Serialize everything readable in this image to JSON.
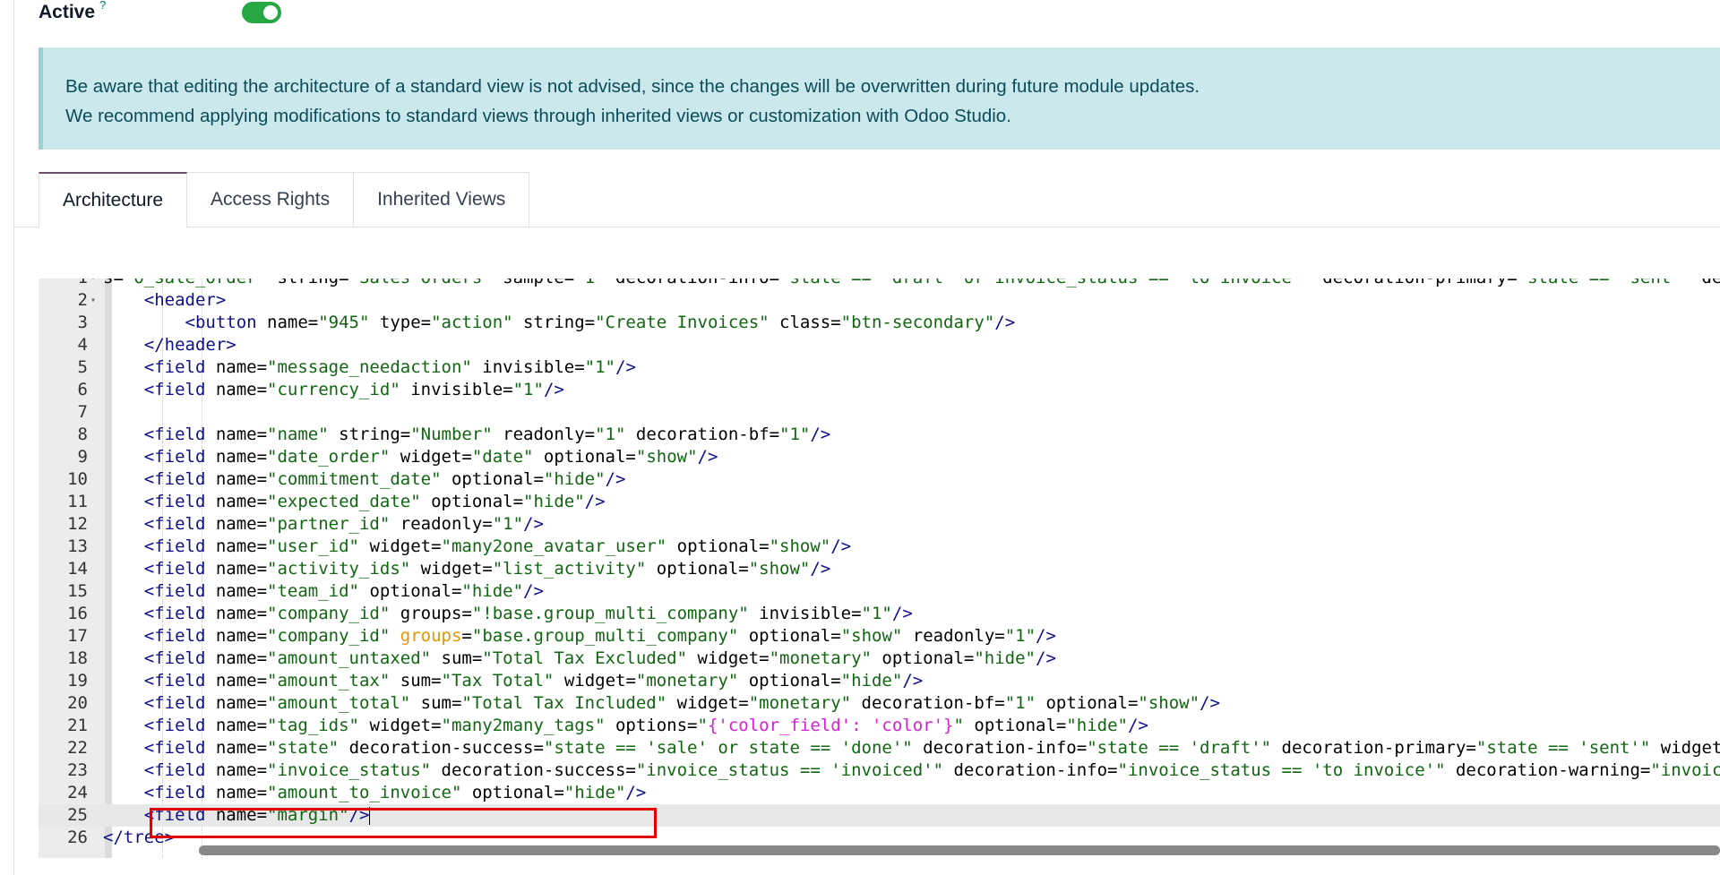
{
  "active_row": {
    "label": "Active",
    "help": "?",
    "toggle_on": true
  },
  "alert": {
    "line1": "Be aware that editing the architecture of a standard view is not advised, since the changes will be overwritten during future module updates.",
    "line2": "We recommend applying modifications to standard views through inherited views or customization with Odoo Studio."
  },
  "tabs": [
    {
      "label": "Architecture",
      "active": true
    },
    {
      "label": "Access Rights",
      "active": false
    },
    {
      "label": "Inherited Views",
      "active": false
    }
  ],
  "editor": {
    "colors": {
      "tag": "#0f0f8c",
      "attr": "#000000",
      "value": "#116611",
      "keyword_attr": "#e69500",
      "option_value": "#d81ed8"
    },
    "current_line": 25,
    "lines": [
      {
        "n": 1,
        "fold": true,
        "tokens": [
          [
            "a",
            "s="
          ],
          [
            "v",
            "\"o_sale_order\""
          ],
          [
            "a",
            " string="
          ],
          [
            "v",
            "\"Sales Orders\""
          ],
          [
            "a",
            " sample="
          ],
          [
            "v",
            "\"1\""
          ],
          [
            "a",
            " decoration-info="
          ],
          [
            "v",
            "\"state == 'draft' or invoice_status == 'to invoice'\""
          ],
          [
            "a",
            " decoration-primary="
          ],
          [
            "v",
            "\"state == 'sent'\""
          ],
          [
            "a",
            " decorati"
          ]
        ]
      },
      {
        "n": 2,
        "fold": true,
        "tokens": [
          [
            "a",
            "    "
          ],
          [
            "t",
            "<header>"
          ]
        ]
      },
      {
        "n": 3,
        "tokens": [
          [
            "a",
            "        "
          ],
          [
            "t",
            "<button"
          ],
          [
            "a",
            " name="
          ],
          [
            "v",
            "\"945\""
          ],
          [
            "a",
            " type="
          ],
          [
            "v",
            "\"action\""
          ],
          [
            "a",
            " string="
          ],
          [
            "v",
            "\"Create Invoices\""
          ],
          [
            "a",
            " class="
          ],
          [
            "v",
            "\"btn-secondary\""
          ],
          [
            "t",
            "/>"
          ]
        ]
      },
      {
        "n": 4,
        "tokens": [
          [
            "a",
            "    "
          ],
          [
            "t",
            "</header>"
          ]
        ]
      },
      {
        "n": 5,
        "tokens": [
          [
            "a",
            "    "
          ],
          [
            "t",
            "<field"
          ],
          [
            "a",
            " name="
          ],
          [
            "v",
            "\"message_needaction\""
          ],
          [
            "a",
            " invisible="
          ],
          [
            "v",
            "\"1\""
          ],
          [
            "t",
            "/>"
          ]
        ]
      },
      {
        "n": 6,
        "tokens": [
          [
            "a",
            "    "
          ],
          [
            "t",
            "<field"
          ],
          [
            "a",
            " name="
          ],
          [
            "v",
            "\"currency_id\""
          ],
          [
            "a",
            " invisible="
          ],
          [
            "v",
            "\"1\""
          ],
          [
            "t",
            "/>"
          ]
        ]
      },
      {
        "n": 7,
        "tokens": []
      },
      {
        "n": 8,
        "tokens": [
          [
            "a",
            "    "
          ],
          [
            "t",
            "<field"
          ],
          [
            "a",
            " name="
          ],
          [
            "v",
            "\"name\""
          ],
          [
            "a",
            " string="
          ],
          [
            "v",
            "\"Number\""
          ],
          [
            "a",
            " readonly="
          ],
          [
            "v",
            "\"1\""
          ],
          [
            "a",
            " decoration-bf="
          ],
          [
            "v",
            "\"1\""
          ],
          [
            "t",
            "/>"
          ]
        ]
      },
      {
        "n": 9,
        "tokens": [
          [
            "a",
            "    "
          ],
          [
            "t",
            "<field"
          ],
          [
            "a",
            " name="
          ],
          [
            "v",
            "\"date_order\""
          ],
          [
            "a",
            " widget="
          ],
          [
            "v",
            "\"date\""
          ],
          [
            "a",
            " optional="
          ],
          [
            "v",
            "\"show\""
          ],
          [
            "t",
            "/>"
          ]
        ]
      },
      {
        "n": 10,
        "tokens": [
          [
            "a",
            "    "
          ],
          [
            "t",
            "<field"
          ],
          [
            "a",
            " name="
          ],
          [
            "v",
            "\"commitment_date\""
          ],
          [
            "a",
            " optional="
          ],
          [
            "v",
            "\"hide\""
          ],
          [
            "t",
            "/>"
          ]
        ]
      },
      {
        "n": 11,
        "tokens": [
          [
            "a",
            "    "
          ],
          [
            "t",
            "<field"
          ],
          [
            "a",
            " name="
          ],
          [
            "v",
            "\"expected_date\""
          ],
          [
            "a",
            " optional="
          ],
          [
            "v",
            "\"hide\""
          ],
          [
            "t",
            "/>"
          ]
        ]
      },
      {
        "n": 12,
        "tokens": [
          [
            "a",
            "    "
          ],
          [
            "t",
            "<field"
          ],
          [
            "a",
            " name="
          ],
          [
            "v",
            "\"partner_id\""
          ],
          [
            "a",
            " readonly="
          ],
          [
            "v",
            "\"1\""
          ],
          [
            "t",
            "/>"
          ]
        ]
      },
      {
        "n": 13,
        "tokens": [
          [
            "a",
            "    "
          ],
          [
            "t",
            "<field"
          ],
          [
            "a",
            " name="
          ],
          [
            "v",
            "\"user_id\""
          ],
          [
            "a",
            " widget="
          ],
          [
            "v",
            "\"many2one_avatar_user\""
          ],
          [
            "a",
            " optional="
          ],
          [
            "v",
            "\"show\""
          ],
          [
            "t",
            "/>"
          ]
        ]
      },
      {
        "n": 14,
        "tokens": [
          [
            "a",
            "    "
          ],
          [
            "t",
            "<field"
          ],
          [
            "a",
            " name="
          ],
          [
            "v",
            "\"activity_ids\""
          ],
          [
            "a",
            " widget="
          ],
          [
            "v",
            "\"list_activity\""
          ],
          [
            "a",
            " optional="
          ],
          [
            "v",
            "\"show\""
          ],
          [
            "t",
            "/>"
          ]
        ]
      },
      {
        "n": 15,
        "tokens": [
          [
            "a",
            "    "
          ],
          [
            "t",
            "<field"
          ],
          [
            "a",
            " name="
          ],
          [
            "v",
            "\"team_id\""
          ],
          [
            "a",
            " optional="
          ],
          [
            "v",
            "\"hide\""
          ],
          [
            "t",
            "/>"
          ]
        ]
      },
      {
        "n": 16,
        "tokens": [
          [
            "a",
            "    "
          ],
          [
            "t",
            "<field"
          ],
          [
            "a",
            " name="
          ],
          [
            "v",
            "\"company_id\""
          ],
          [
            "a",
            " groups="
          ],
          [
            "v",
            "\"!base.group_multi_company\""
          ],
          [
            "a",
            " invisible="
          ],
          [
            "v",
            "\"1\""
          ],
          [
            "t",
            "/>"
          ]
        ]
      },
      {
        "n": 17,
        "tokens": [
          [
            "a",
            "    "
          ],
          [
            "t",
            "<field"
          ],
          [
            "a",
            " name="
          ],
          [
            "v",
            "\"company_id\""
          ],
          [
            "a",
            " "
          ],
          [
            "k",
            "groups"
          ],
          [
            "a",
            "="
          ],
          [
            "v",
            "\"base.group_multi_company\""
          ],
          [
            "a",
            " optional="
          ],
          [
            "v",
            "\"show\""
          ],
          [
            "a",
            " readonly="
          ],
          [
            "v",
            "\"1\""
          ],
          [
            "t",
            "/>"
          ]
        ]
      },
      {
        "n": 18,
        "tokens": [
          [
            "a",
            "    "
          ],
          [
            "t",
            "<field"
          ],
          [
            "a",
            " name="
          ],
          [
            "v",
            "\"amount_untaxed\""
          ],
          [
            "a",
            " sum="
          ],
          [
            "v",
            "\"Total Tax Excluded\""
          ],
          [
            "a",
            " widget="
          ],
          [
            "v",
            "\"monetary\""
          ],
          [
            "a",
            " optional="
          ],
          [
            "v",
            "\"hide\""
          ],
          [
            "t",
            "/>"
          ]
        ]
      },
      {
        "n": 19,
        "tokens": [
          [
            "a",
            "    "
          ],
          [
            "t",
            "<field"
          ],
          [
            "a",
            " name="
          ],
          [
            "v",
            "\"amount_tax\""
          ],
          [
            "a",
            " sum="
          ],
          [
            "v",
            "\"Tax Total\""
          ],
          [
            "a",
            " widget="
          ],
          [
            "v",
            "\"monetary\""
          ],
          [
            "a",
            " optional="
          ],
          [
            "v",
            "\"hide\""
          ],
          [
            "t",
            "/>"
          ]
        ]
      },
      {
        "n": 20,
        "tokens": [
          [
            "a",
            "    "
          ],
          [
            "t",
            "<field"
          ],
          [
            "a",
            " name="
          ],
          [
            "v",
            "\"amount_total\""
          ],
          [
            "a",
            " sum="
          ],
          [
            "v",
            "\"Total Tax Included\""
          ],
          [
            "a",
            " widget="
          ],
          [
            "v",
            "\"monetary\""
          ],
          [
            "a",
            " decoration-bf="
          ],
          [
            "v",
            "\"1\""
          ],
          [
            "a",
            " optional="
          ],
          [
            "v",
            "\"show\""
          ],
          [
            "t",
            "/>"
          ]
        ]
      },
      {
        "n": 21,
        "tokens": [
          [
            "a",
            "    "
          ],
          [
            "t",
            "<field"
          ],
          [
            "a",
            " name="
          ],
          [
            "v",
            "\"tag_ids\""
          ],
          [
            "a",
            " widget="
          ],
          [
            "v",
            "\"many2many_tags\""
          ],
          [
            "a",
            " options="
          ],
          [
            "v",
            "\""
          ],
          [
            "o",
            "{'color_field': 'color'}"
          ],
          [
            "v",
            "\""
          ],
          [
            "a",
            " optional="
          ],
          [
            "v",
            "\"hide\""
          ],
          [
            "t",
            "/>"
          ]
        ]
      },
      {
        "n": 22,
        "tokens": [
          [
            "a",
            "    "
          ],
          [
            "t",
            "<field"
          ],
          [
            "a",
            " name="
          ],
          [
            "v",
            "\"state\""
          ],
          [
            "a",
            " decoration-success="
          ],
          [
            "v",
            "\"state == 'sale' or state == 'done'\""
          ],
          [
            "a",
            " decoration-info="
          ],
          [
            "v",
            "\"state == 'draft'\""
          ],
          [
            "a",
            " decoration-primary="
          ],
          [
            "v",
            "\"state == 'sent'\""
          ],
          [
            "a",
            " widget=\""
          ]
        ]
      },
      {
        "n": 23,
        "tokens": [
          [
            "a",
            "    "
          ],
          [
            "t",
            "<field"
          ],
          [
            "a",
            " name="
          ],
          [
            "v",
            "\"invoice_status\""
          ],
          [
            "a",
            " decoration-success="
          ],
          [
            "v",
            "\"invoice_status == 'invoiced'\""
          ],
          [
            "a",
            " decoration-info="
          ],
          [
            "v",
            "\"invoice_status == 'to invoice'\""
          ],
          [
            "a",
            " decoration-warning="
          ],
          [
            "v",
            "\"invoice_s"
          ]
        ]
      },
      {
        "n": 24,
        "tokens": [
          [
            "a",
            "    "
          ],
          [
            "t",
            "<field"
          ],
          [
            "a",
            " name="
          ],
          [
            "v",
            "\"amount_to_invoice\""
          ],
          [
            "a",
            " optional="
          ],
          [
            "v",
            "\"hide\""
          ],
          [
            "t",
            "/>"
          ]
        ]
      },
      {
        "n": 25,
        "tokens": [
          [
            "a",
            "    "
          ],
          [
            "t",
            "<field"
          ],
          [
            "a",
            " name="
          ],
          [
            "v",
            "\"margin\""
          ],
          [
            "t",
            "/>"
          ]
        ]
      },
      {
        "n": 26,
        "tokens": [
          [
            "t",
            "</tree>"
          ]
        ]
      }
    ]
  }
}
